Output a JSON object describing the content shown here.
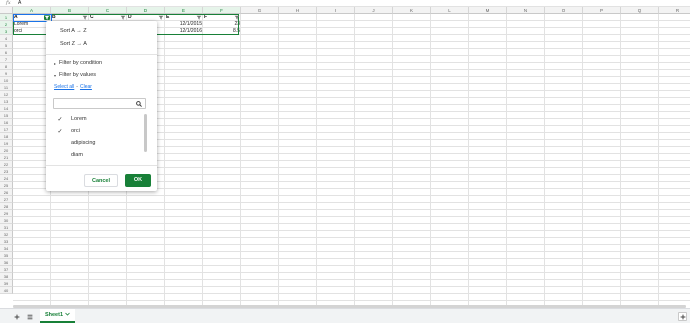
{
  "formula_bar": {
    "icon": "fx-icon",
    "value": "A"
  },
  "columns": [
    "A",
    "B",
    "C",
    "D",
    "E",
    "F",
    "G",
    "H",
    "I",
    "J",
    "K",
    "L",
    "M",
    "N",
    "O",
    "P",
    "Q",
    "R"
  ],
  "rows": [
    "1",
    "2",
    "3",
    "4",
    "5",
    "6",
    "7",
    "8",
    "9",
    "10",
    "11",
    "12",
    "13",
    "14",
    "15",
    "16",
    "17",
    "18",
    "19",
    "20",
    "21",
    "22",
    "23",
    "24",
    "25",
    "26",
    "27",
    "28",
    "29",
    "30",
    "31",
    "32",
    "33",
    "34",
    "35",
    "36",
    "37",
    "38",
    "39",
    "40"
  ],
  "cells": {
    "A1": "A",
    "B1": "B",
    "C1": "C",
    "D1": "D",
    "E1": "E",
    "F1": "F",
    "A2": "Lorem",
    "E2": "12/1/2015",
    "F2": "23",
    "A3": "orci",
    "E3": "12/1/2016",
    "F3": "8.5"
  },
  "filter_menu": {
    "sort_az": "Sort A → Z",
    "sort_za": "Sort Z → A",
    "filter_by_condition": "Filter by condition",
    "filter_by_values": "Filter by values",
    "select_all": "Select all",
    "separator": "-",
    "clear": "Clear",
    "search_value": "",
    "values": [
      {
        "label": "Lorem",
        "checked": true
      },
      {
        "label": "orci",
        "checked": true
      },
      {
        "label": "adipiscing",
        "checked": false
      },
      {
        "label": "diam",
        "checked": false
      }
    ],
    "cancel_label": "Cancel",
    "ok_label": "OK"
  },
  "sheet_bar": {
    "add_sheet_icon": "plus-icon",
    "all_sheets_icon": "list-icon",
    "active_tab": "Sheet1",
    "explore_icon": "explore-icon"
  },
  "colors": {
    "accent": "#188038",
    "selection": "#1a73e8",
    "link": "#1a73e8",
    "header_bg": "#f3f3f3"
  }
}
